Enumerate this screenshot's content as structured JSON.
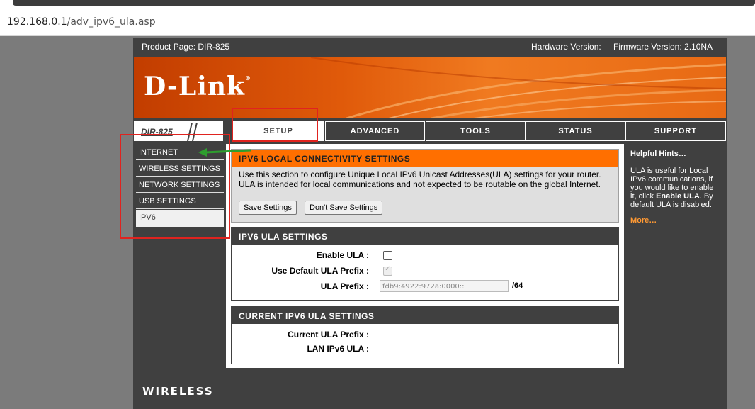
{
  "browser": {
    "url_host": "192.168.0.1",
    "url_path": "/adv_ipv6_ula.asp"
  },
  "header": {
    "product_page": "Product Page: DIR-825",
    "hardware_version": "Hardware Version:",
    "firmware_version": "Firmware Version: 2.10NA"
  },
  "logo": {
    "text": "D-Link",
    "reg": "®"
  },
  "model": "DIR-825",
  "tabs": [
    {
      "label": "SETUP"
    },
    {
      "label": "ADVANCED"
    },
    {
      "label": "TOOLS"
    },
    {
      "label": "STATUS"
    },
    {
      "label": "SUPPORT"
    }
  ],
  "leftnav": [
    {
      "label": "INTERNET"
    },
    {
      "label": "WIRELESS SETTINGS"
    },
    {
      "label": "NETWORK SETTINGS"
    },
    {
      "label": "USB SETTINGS"
    },
    {
      "label": "IPV6"
    }
  ],
  "section1": {
    "title": "IPV6 LOCAL CONNECTIVITY SETTINGS",
    "line1": "Use this section to configure Unique Local IPv6 Unicast Addresses(ULA) settings for your router.",
    "line2": "ULA is intended for local communications and not expected to be routable on the global Internet.",
    "save": "Save Settings",
    "dont_save": "Don't Save Settings"
  },
  "section2": {
    "title": "IPV6 ULA SETTINGS",
    "enable_label": "Enable ULA :",
    "default_label": "Use Default ULA Prefix :",
    "prefix_label": "ULA Prefix :",
    "prefix_value": "fdb9:4922:972a:0000::",
    "prefix_suffix": "/64"
  },
  "section3": {
    "title": "CURRENT IPV6 ULA SETTINGS",
    "current_prefix_label": "Current ULA Prefix :",
    "lan_label": "LAN IPv6 ULA :"
  },
  "hints": {
    "title": "Helpful Hints…",
    "body_pre": "ULA is useful for Local IPv6 communications, if you would like to enable it, click ",
    "body_bold": "Enable ULA",
    "body_post": ". By default ULA is disabled.",
    "more": "More…"
  },
  "footer": {
    "label": "WIRELESS"
  },
  "colors": {
    "accent_orange": "#ff6f00",
    "dark": "#404040",
    "annotation_red": "#e0231f",
    "annotation_green": "#2e9e2e"
  }
}
